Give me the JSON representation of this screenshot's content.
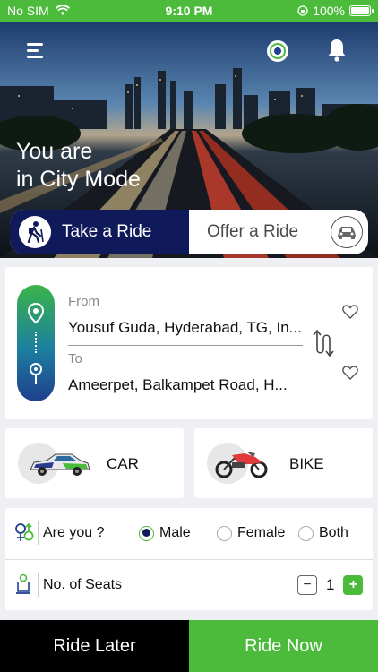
{
  "status_bar": {
    "carrier": "No SIM",
    "time": "9:10 PM",
    "battery": "100%"
  },
  "hero": {
    "title_line1": "You are",
    "title_line2": "in City Mode"
  },
  "ride_toggle": {
    "take_label": "Take a Ride",
    "offer_label": "Offer a Ride",
    "selected": "take"
  },
  "location": {
    "from_label": "From",
    "from_value": "Yousuf Guda, Hyderabad, TG, In...",
    "to_label": "To",
    "to_value": "Ameerpet, Balkampet Road, H..."
  },
  "vehicles": [
    {
      "label": "CAR",
      "icon": "car-icon"
    },
    {
      "label": "BIKE",
      "icon": "bike-icon"
    }
  ],
  "gender": {
    "label": "Are you ?",
    "options": [
      "Male",
      "Female",
      "Both"
    ],
    "selected": "Male"
  },
  "seats": {
    "label": "No. of Seats",
    "value": "1"
  },
  "actions": {
    "ride_later": "Ride Later",
    "ride_now": "Ride Now"
  },
  "colors": {
    "accent_green": "#4cbb3c",
    "navy": "#101a5a"
  }
}
